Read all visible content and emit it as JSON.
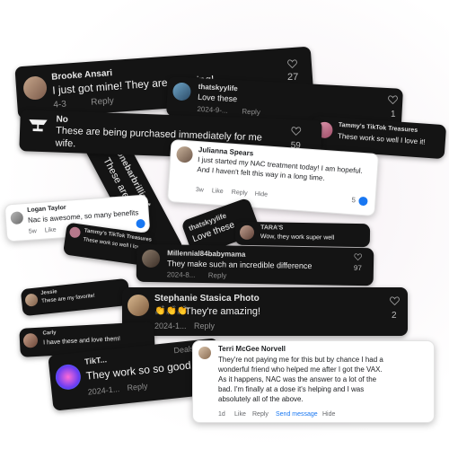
{
  "comments": {
    "brooke": {
      "name": "Brooke Ansari",
      "text": "I just got mine! They are amazing!",
      "date": "4-3",
      "reply": "Reply",
      "likes": "27"
    },
    "thatskyylife": {
      "name": "thatskyylife",
      "text": "Love these",
      "date": "2024-9-...",
      "reply": "Reply",
      "likes": "1"
    },
    "no": {
      "name": "No",
      "text_line1": "These are being purchased immediately for me",
      "text_line2": "wife.",
      "likes": "59"
    },
    "tammy": {
      "name": "Tammy's TikTok Treasures",
      "text": "These work so well I love it!"
    },
    "julianna": {
      "name": "Julianna Spears",
      "line1": "I just started my NAC treatment today! I am hopeful.",
      "line2": "And I haven't felt this way in a long time.",
      "time": "3w",
      "like": "Like",
      "reply": "Reply",
      "hide": "Hide",
      "reactions": "5"
    },
    "logan": {
      "name": "Logan Taylor",
      "text": "Nac is awesome, so many benefits",
      "time": "5w",
      "like": "Like"
    },
    "rotated_top": {
      "name": "onebarbrilliant",
      "text": "These are the"
    },
    "tammy2": {
      "name": "Tammy's TikTok Treasures",
      "text": "These work so well I love it!"
    },
    "skyy2": {
      "name": "thatskyylife",
      "text": "Love these"
    },
    "tara": {
      "name": "TARA'S",
      "text": "Wow, they work super well"
    },
    "millennial": {
      "name": "Millennial84babymama",
      "text": "They make such an incredible difference",
      "date": "2024-8...",
      "reply": "Reply",
      "likes": "97"
    },
    "jessie": {
      "name": "Jessie",
      "text": "These are my favorite!"
    },
    "stephanie": {
      "name": "Stephanie Stasica Photo",
      "emoji": "👏👏👏",
      "text": "They're amazing!",
      "date": "2024-1...",
      "reply": "Reply",
      "likes": "2"
    },
    "carly": {
      "name": "Carly",
      "text": "I have these and love them!"
    },
    "tiktok_bottom": {
      "name": "TikT...",
      "text": "They work so so good",
      "date": "2024-1...",
      "reply": "Reply",
      "tag": "Deals"
    },
    "terri": {
      "name": "Terri McGee Norvell",
      "lines": [
        "They're not paying me for this but by chance I had a",
        "wonderful friend who helped me after I got the VAX.",
        "As it happens, NAC was the answer to a lot of the",
        "bad. I'm finally at a dose it's helping and I was",
        "absolutely all of the above."
      ],
      "time": "1d",
      "like": "Like",
      "reply": "Reply",
      "send": "Send message",
      "hide": "Hide"
    }
  },
  "colors": {
    "dark_card": "#141414",
    "light_card": "#ffffff",
    "link_blue": "#1877f2",
    "heart": "#9a9a9a"
  }
}
